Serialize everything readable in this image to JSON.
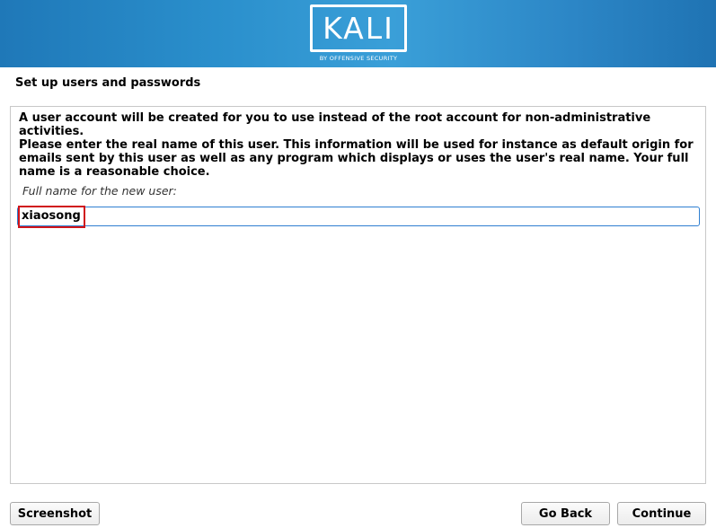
{
  "header": {
    "logo_text": "KALI",
    "logo_subtitle": "BY OFFENSIVE SECURITY"
  },
  "page": {
    "title": "Set up users and passwords"
  },
  "content": {
    "paragraph1": "A user account will be created for you to use instead of the root account for non-administrative activities.",
    "paragraph2": "Please enter the real name of this user. This information will be used for instance as default origin for emails sent by this user as well as any program which displays or uses the user's real name. Your full name is a reasonable choice.",
    "field_label": "Full name for the new user:",
    "field_value": "xiaosong"
  },
  "buttons": {
    "screenshot": "Screenshot",
    "go_back": "Go Back",
    "continue": "Continue"
  },
  "colors": {
    "banner": "#2a8fcc",
    "input_focus": "#2f7fd1",
    "highlight": "#d0141a"
  }
}
